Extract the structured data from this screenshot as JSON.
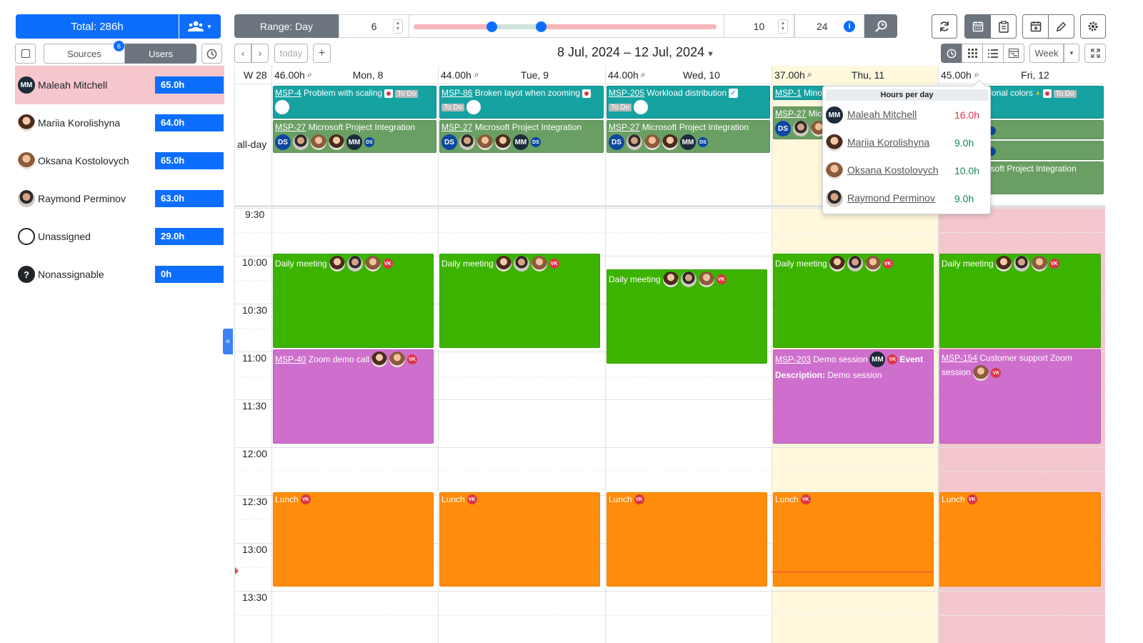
{
  "left": {
    "total_label": "Total: 286h",
    "badge_count": "6",
    "tabs": {
      "sources": "Sources",
      "users": "Users"
    },
    "users": [
      {
        "name": "Maleah Mitchell",
        "hours": "65.0h",
        "avatar": "MM",
        "selected": true
      },
      {
        "name": "Mariia Korolishyna",
        "hours": "64.0h"
      },
      {
        "name": "Oksana Kostolovych",
        "hours": "65.0h"
      },
      {
        "name": "Raymond Perminov",
        "hours": "63.0h"
      },
      {
        "name": "Unassigned",
        "hours": "29.0h"
      },
      {
        "name": "Nonassignable",
        "hours": "0h",
        "icon": "?"
      }
    ]
  },
  "toolbar": {
    "range_label": "Range: Day",
    "range_start": "6",
    "slider_low": "10",
    "slider_high": "24",
    "today_label": "today",
    "week_label": "Week",
    "title": "8 Jul, 2024 – 12 Jul, 2024"
  },
  "calendar": {
    "week_label": "W 28",
    "allday_label": "all-day",
    "days": [
      {
        "hours": "46.00h",
        "label": "Mon, 8"
      },
      {
        "hours": "44.00h",
        "label": "Tue, 9"
      },
      {
        "hours": "44.00h",
        "label": "Wed, 10"
      },
      {
        "hours": "37.00h",
        "label": "Thu, 11"
      },
      {
        "hours": "45.00h",
        "label": "Fri, 12"
      }
    ],
    "times": [
      "9:30",
      "10:00",
      "10:30",
      "11:00",
      "11:30",
      "12:00",
      "12:30",
      "13:00",
      "13:30"
    ],
    "allday_events": {
      "mon_top": {
        "key": "MSP-4",
        "title": " Problem with scaling",
        "status": "To Do"
      },
      "tue_top": {
        "key": "MSP-86",
        "title": " Broken layot when zooming",
        "status": "To Do"
      },
      "wed_top": {
        "key": "MSP-205",
        "title": " Workload distribution",
        "status": "To Do"
      },
      "thu_top": {
        "key": "MSP-1",
        "title": " Mino"
      },
      "thu_mid": {
        "key": "MSP-27",
        "title": " Mic"
      },
      "fri_top": {
        "title": "tional colors",
        "status": "To Do"
      },
      "fri_bottom": {
        "title": "osoft Project Integration"
      },
      "integration": {
        "key": "MSP-27",
        "title": " Microsoft Project Integration"
      }
    },
    "events": {
      "daily": "Daily meeting",
      "lunch": "Lunch",
      "zoom": {
        "key": "MSP-40",
        "title": " Zoom demo call"
      },
      "demo": {
        "key": "MSP-203",
        "title": " Demo session",
        "tag": "Event",
        "desc_label": "Description:",
        "desc": " Demo session"
      },
      "support": {
        "key": "MSP-154",
        "title": " Customer support Zoom session"
      }
    },
    "initials": {
      "mm": "MM",
      "ds": "DS",
      "vk": "VK"
    }
  },
  "popup": {
    "title": "Hours per day",
    "rows": [
      {
        "name": "Maleah Mitchell",
        "value": "16.0h",
        "color": "#dc3545"
      },
      {
        "name": "Mariia Korolishyna",
        "value": "9.0h",
        "color": "#198754"
      },
      {
        "name": "Oksana Kostolovych",
        "value": "10.0h",
        "color": "#198754"
      },
      {
        "name": "Raymond Perminov",
        "value": "9.0h",
        "color": "#198754"
      }
    ]
  },
  "colors": {
    "accent": "#0d6efd",
    "today_bg": "#fff8dc",
    "fri_bg": "#f4c7cc"
  }
}
